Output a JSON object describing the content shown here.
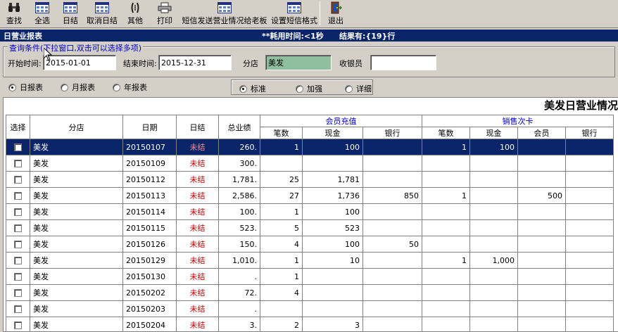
{
  "toolbar": {
    "buttons": [
      {
        "label": "查找",
        "icon": "binoculars-icon"
      },
      {
        "label": "全选",
        "icon": "grid-icon"
      },
      {
        "label": "日结",
        "icon": "grid-icon"
      },
      {
        "label": "取消日结",
        "icon": "grid-icon"
      },
      {
        "label": "其他",
        "icon": "bracket-icon"
      },
      {
        "label": "打印",
        "icon": "printer-icon"
      },
      {
        "label": "短信发送营业情况给老板",
        "icon": "grid-icon"
      },
      {
        "label": "设置短信格式",
        "icon": "grid-icon"
      },
      {
        "label": "退出",
        "icon": "exit-door-icon"
      }
    ]
  },
  "titlebar": {
    "title": "日营业报表",
    "elapsed": "**耗用时间:<1秒",
    "result": "结果有:{19}行"
  },
  "query": {
    "legend": "查询条件(下拉窗口,双击可以选择多项)",
    "start_label": "开始时间:",
    "start_value": "2015-01-01",
    "end_label": "结束时间:",
    "end_value": "2015-12-31",
    "branch_label": "分店",
    "branch_value": "美发",
    "cashier_label": "收银员",
    "cashier_value": ""
  },
  "period": {
    "options": [
      "日报表",
      "月报表",
      "年报表"
    ],
    "selected": 0
  },
  "mode": {
    "options": [
      "标准",
      "加强",
      "详细"
    ],
    "selected": 0
  },
  "report": {
    "title": "美发日营业情况",
    "group_member": "会员充值",
    "group_sales": "销售次卡",
    "headers": [
      "选择",
      "分店",
      "日期",
      "日结",
      "总业绩"
    ],
    "sub_member": [
      "笔数",
      "现金",
      "银行"
    ],
    "sub_sales": [
      "笔数",
      "现金",
      "会员",
      "银行"
    ],
    "rows": [
      {
        "branch": "美发",
        "date": "20150107",
        "status": "未结",
        "total": "260.",
        "m_count": "1",
        "m_cash": "100",
        "m_bank": "",
        "s_count": "1",
        "s_cash": "100",
        "s_member": "",
        "s_bank": ""
      },
      {
        "branch": "美发",
        "date": "20150109",
        "status": "未结",
        "total": "300.",
        "m_count": "",
        "m_cash": "",
        "m_bank": "",
        "s_count": "",
        "s_cash": "",
        "s_member": "",
        "s_bank": ""
      },
      {
        "branch": "美发",
        "date": "20150112",
        "status": "未结",
        "total": "1,781.",
        "m_count": "25",
        "m_cash": "1,781",
        "m_bank": "",
        "s_count": "",
        "s_cash": "",
        "s_member": "",
        "s_bank": ""
      },
      {
        "branch": "美发",
        "date": "20150113",
        "status": "未结",
        "total": "2,586.",
        "m_count": "27",
        "m_cash": "1,736",
        "m_bank": "850",
        "s_count": "1",
        "s_cash": "",
        "s_member": "500",
        "s_bank": ""
      },
      {
        "branch": "美发",
        "date": "20150114",
        "status": "未结",
        "total": "100.",
        "m_count": "1",
        "m_cash": "100",
        "m_bank": "",
        "s_count": "",
        "s_cash": "",
        "s_member": "",
        "s_bank": ""
      },
      {
        "branch": "美发",
        "date": "20150115",
        "status": "未结",
        "total": "523.",
        "m_count": "5",
        "m_cash": "523",
        "m_bank": "",
        "s_count": "",
        "s_cash": "",
        "s_member": "",
        "s_bank": ""
      },
      {
        "branch": "美发",
        "date": "20150126",
        "status": "未结",
        "total": "150.",
        "m_count": "4",
        "m_cash": "100",
        "m_bank": "50",
        "s_count": "",
        "s_cash": "",
        "s_member": "",
        "s_bank": ""
      },
      {
        "branch": "美发",
        "date": "20150129",
        "status": "未结",
        "total": "1,010.",
        "m_count": "1",
        "m_cash": "10",
        "m_bank": "",
        "s_count": "1",
        "s_cash": "1,000",
        "s_member": "",
        "s_bank": ""
      },
      {
        "branch": "美发",
        "date": "20150130",
        "status": "未结",
        "total": ".",
        "m_count": "1",
        "m_cash": "",
        "m_bank": "",
        "s_count": "",
        "s_cash": "",
        "s_member": "",
        "s_bank": ""
      },
      {
        "branch": "美发",
        "date": "20150202",
        "status": "未结",
        "total": "72.",
        "m_count": "4",
        "m_cash": "",
        "m_bank": "",
        "s_count": "",
        "s_cash": "",
        "s_member": "",
        "s_bank": ""
      },
      {
        "branch": "美发",
        "date": "20150203",
        "status": "未结",
        "total": ".",
        "m_count": "",
        "m_cash": "",
        "m_bank": "",
        "s_count": "",
        "s_cash": "",
        "s_member": "",
        "s_bank": ""
      },
      {
        "branch": "美发",
        "date": "20150204",
        "status": "未结",
        "total": "3.",
        "m_count": "2",
        "m_cash": "3",
        "m_bank": "",
        "s_count": "",
        "s_cash": "",
        "s_member": "",
        "s_bank": ""
      }
    ]
  },
  "colors": {
    "selection": "#0a246a",
    "unsettled": "#c00000",
    "group_header": "#0000c0",
    "branch_field": "#8fbf9f"
  }
}
